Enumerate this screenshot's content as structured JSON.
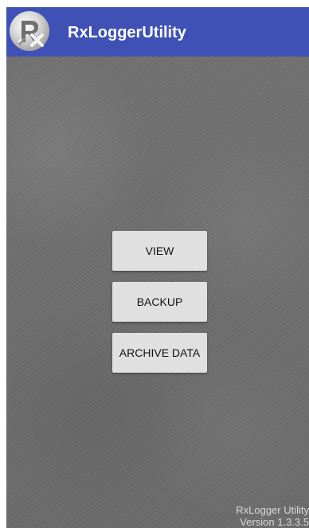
{
  "app": {
    "title": "RxLoggerUtility",
    "logo_icon": "rx-logger-logo-icon"
  },
  "actions": {
    "view_label": "VIEW",
    "backup_label": "BACKUP",
    "archive_label": "ARCHIVE DATA"
  },
  "footer": {
    "app_name": "RxLogger Utility",
    "version": "Version 1.3.3.5"
  },
  "colors": {
    "app_bar": "#3f51b5",
    "button": "#e0e0e0",
    "background": "#6d6d6d"
  }
}
